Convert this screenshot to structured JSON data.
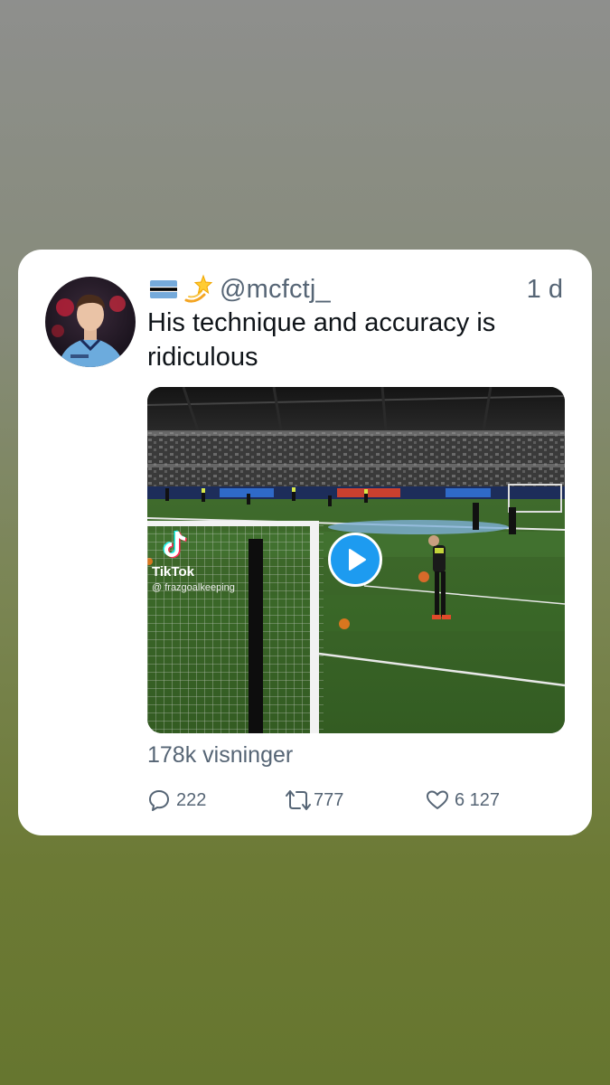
{
  "tweet": {
    "handle": "@mcfctj_",
    "time": "1 d",
    "text": "His technique and accuracy is ridiculous",
    "views": "178k visninger",
    "flag_emoji": "botswana-flag",
    "sparkle_emoji": "dizzy-star",
    "avatar_icon": "profile-photo-avatar"
  },
  "media": {
    "watermark_name": "TikTok",
    "watermark_user": "@ frazgoalkeeping",
    "play_icon": "play-icon"
  },
  "actions": {
    "replies": "222",
    "retweets": "777",
    "likes": "6 127",
    "reply_icon": "comment-icon",
    "retweet_icon": "retweet-icon",
    "like_icon": "heart-icon"
  },
  "colors": {
    "accent": "#1d9bf0",
    "muted_text": "#566575",
    "text": "#0f1419",
    "card_bg": "#ffffff"
  }
}
